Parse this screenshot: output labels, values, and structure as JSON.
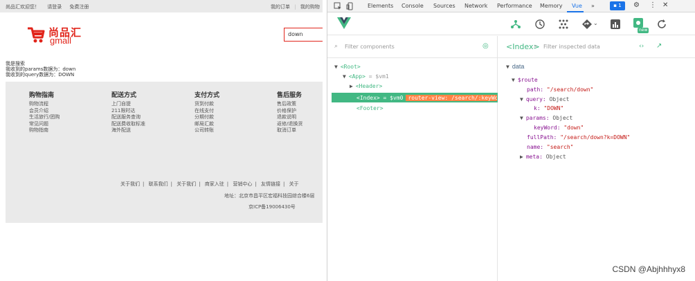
{
  "page": {
    "topbar": {
      "welcome": "尚品汇欢迎您！",
      "login": "请登录",
      "register": "免费注册",
      "my_orders": "我的订单",
      "my_cart": "我的购物"
    },
    "logo_cn": "尚品汇",
    "logo_en": "gmall",
    "search_value": "down",
    "messages": [
      "我是搜索",
      "我收到的params数据为：down",
      "我收到的query数据为：DOWN"
    ],
    "footer_columns": [
      {
        "title": "购物指南",
        "items": [
          "购物流程",
          "会员介绍",
          "生活旅行/团购",
          "常见问题",
          "购物指南"
        ]
      },
      {
        "title": "配送方式",
        "items": [
          "上门自提",
          "211限时达",
          "配送服务查询",
          "配送费收取标准",
          "海外配送"
        ]
      },
      {
        "title": "支付方式",
        "items": [
          "货到付款",
          "在线支付",
          "分期付款",
          "邮局汇款",
          "公司转账"
        ]
      },
      {
        "title": "售后服务",
        "items": [
          "售后政策",
          "价格保护",
          "退款说明",
          "返修/退换货",
          "取消订单"
        ]
      }
    ],
    "footer_links": [
      "关于我们",
      "联系我们",
      "关于我们",
      "商家入驻",
      "营销中心",
      "友情链接",
      "关于"
    ],
    "address": "地址：北京市昌平区宏福科技园综合楼6层",
    "icp": "京ICP备19006430号"
  },
  "devtools": {
    "tabs": [
      "Elements",
      "Console",
      "Sources",
      "Network",
      "Performance",
      "Memory",
      "Vue",
      "»"
    ],
    "active_tab": "Vue",
    "badge_count": "1",
    "filter_components_placeholder": "Filter components",
    "selected_component": "<Index>",
    "filter_inspected_placeholder": "Filter inspected data",
    "new_badge": "new",
    "tree": {
      "root": "<Root>",
      "app": "<App>",
      "app_vm": "= $vm1",
      "header": "<Header>",
      "index": "<Index>",
      "index_vm": "= $vm0",
      "index_route": "router-view: /search/:keyWord",
      "footer": "<Footer>"
    },
    "inspector": {
      "section": "data",
      "route_key": "$route",
      "path_key": "path:",
      "path_val": "\"/search/down\"",
      "query_key": "query:",
      "query_type": "Object",
      "k_key": "k:",
      "k_val": "\"DOWN\"",
      "params_key": "params:",
      "params_type": "Object",
      "keyword_key": "keyWord:",
      "keyword_val": "\"down\"",
      "fullpath_key": "fullPath:",
      "fullpath_val": "\"/search/down?k=DOWN\"",
      "name_key": "name:",
      "name_val": "\"search\"",
      "meta_key": "meta:",
      "meta_type": "Object"
    },
    "watermark": "CSDN @Abjhhhyx8"
  }
}
